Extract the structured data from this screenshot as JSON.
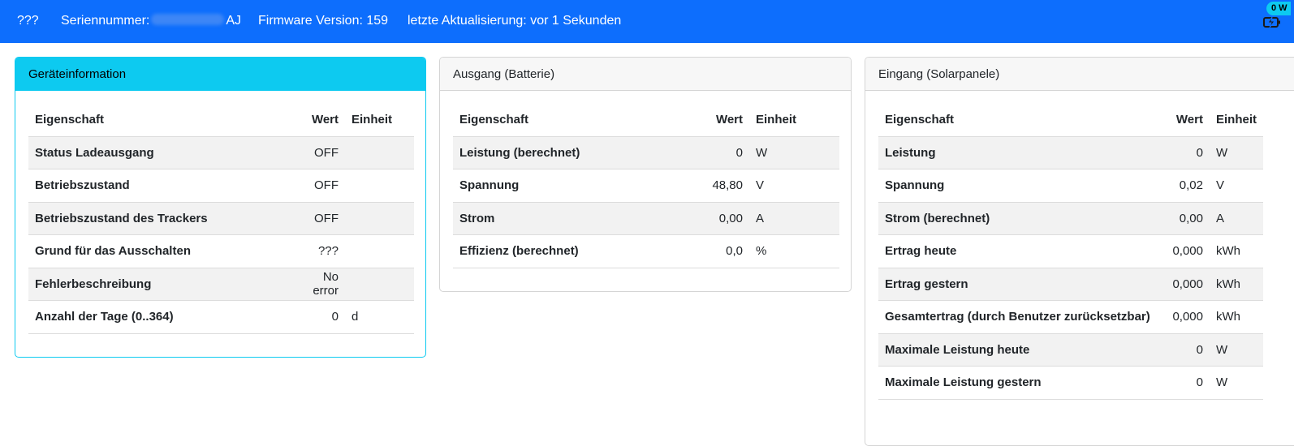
{
  "header": {
    "device_name": "???",
    "serial_label": "Seriennummer:",
    "serial_suffix": "AJ",
    "firmware": "Firmware Version: 159",
    "last_update": "letzte Aktualisierung: vor 1 Sekunden",
    "power_badge": "0 W",
    "power_icon": "charging-battery-icon"
  },
  "colors": {
    "navbar": "#0d6efd",
    "info_header": "#0dcaf0"
  },
  "cards": {
    "device": {
      "title": "Geräteinformation",
      "columns": [
        "Eigenschaft",
        "Wert",
        "Einheit"
      ],
      "rows": [
        {
          "prop": "Status Ladeausgang",
          "value": "OFF",
          "unit": ""
        },
        {
          "prop": "Betriebszustand",
          "value": "OFF",
          "unit": ""
        },
        {
          "prop": "Betriebszustand des Trackers",
          "value": "OFF",
          "unit": ""
        },
        {
          "prop": "Grund für das Ausschalten",
          "value": "???",
          "unit": ""
        },
        {
          "prop": "Fehlerbeschreibung",
          "value": "No error",
          "unit": ""
        },
        {
          "prop": "Anzahl der Tage (0..364)",
          "value": "0",
          "unit": "d"
        }
      ]
    },
    "output": {
      "title": "Ausgang (Batterie)",
      "columns": [
        "Eigenschaft",
        "Wert",
        "Einheit"
      ],
      "rows": [
        {
          "prop": "Leistung (berechnet)",
          "value": "0",
          "unit": "W"
        },
        {
          "prop": "Spannung",
          "value": "48,80",
          "unit": "V"
        },
        {
          "prop": "Strom",
          "value": "0,00",
          "unit": "A"
        },
        {
          "prop": "Effizienz (berechnet)",
          "value": "0,0",
          "unit": "%"
        }
      ]
    },
    "input": {
      "title": "Eingang (Solarpanele)",
      "columns": [
        "Eigenschaft",
        "Wert",
        "Einheit"
      ],
      "rows": [
        {
          "prop": "Leistung",
          "value": "0",
          "unit": "W"
        },
        {
          "prop": "Spannung",
          "value": "0,02",
          "unit": "V"
        },
        {
          "prop": "Strom (berechnet)",
          "value": "0,00",
          "unit": "A"
        },
        {
          "prop": "Ertrag heute",
          "value": "0,000",
          "unit": "kWh"
        },
        {
          "prop": "Ertrag gestern",
          "value": "0,000",
          "unit": "kWh"
        },
        {
          "prop": "Gesamtertrag (durch Benutzer zurücksetzbar)",
          "value": "0,000",
          "unit": "kWh"
        },
        {
          "prop": "Maximale Leistung heute",
          "value": "0",
          "unit": "W"
        },
        {
          "prop": "Maximale Leistung gestern",
          "value": "0",
          "unit": "W"
        }
      ]
    }
  }
}
